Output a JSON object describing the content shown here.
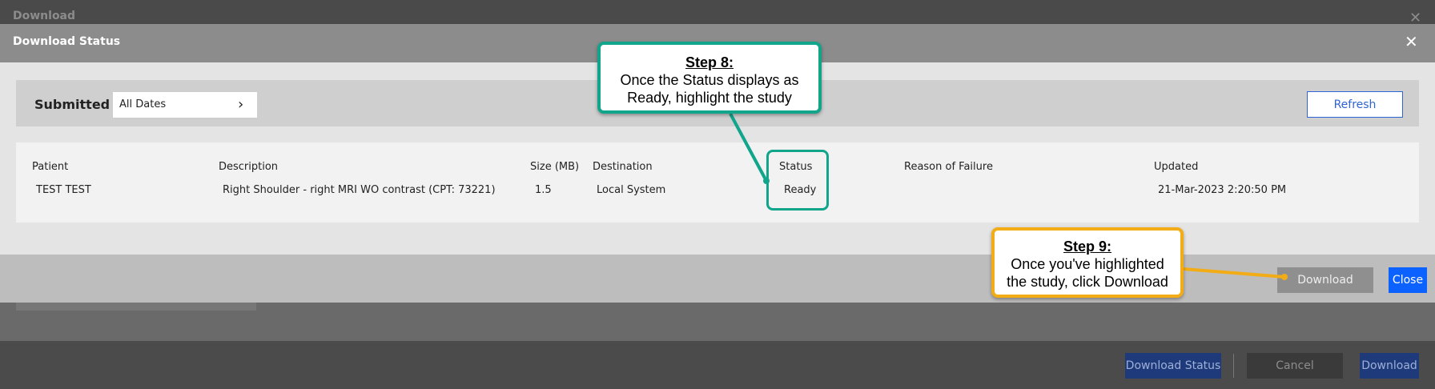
{
  "background_dialog": {
    "title": "Download",
    "buttons": {
      "status": "Download Status",
      "cancel": "Cancel",
      "download": "Download"
    }
  },
  "modal": {
    "title": "Download Status",
    "submitted_label": "Submitted",
    "date_filter": "All Dates",
    "refresh": "Refresh",
    "columns": {
      "patient": "Patient",
      "description": "Description",
      "size": "Size (MB)",
      "destination": "Destination",
      "status": "Status",
      "reason": "Reason of Failure",
      "updated": "Updated"
    },
    "row": {
      "patient": "TEST TEST",
      "description": "Right Shoulder - right MRI WO contrast (CPT: 73221)",
      "size": "1.5",
      "destination": "Local System",
      "status": "Ready",
      "reason": "",
      "updated": "21-Mar-2023 2:20:50 PM"
    },
    "footer": {
      "download": "Download",
      "close": "Close"
    }
  },
  "callouts": {
    "step8": {
      "heading": "Step 8:",
      "line1": "Once the Status displays as",
      "line2": "Ready, highlight the study"
    },
    "step9": {
      "heading": "Step 9:",
      "line1": "Once you've highlighted",
      "line2": "the study, click Download"
    }
  },
  "colors": {
    "accent": "#0b62ff",
    "step8": "#11a58c",
    "step9": "#f2ac15"
  },
  "icons": {
    "close": "close-icon",
    "chevron": "chevron-right-icon"
  }
}
